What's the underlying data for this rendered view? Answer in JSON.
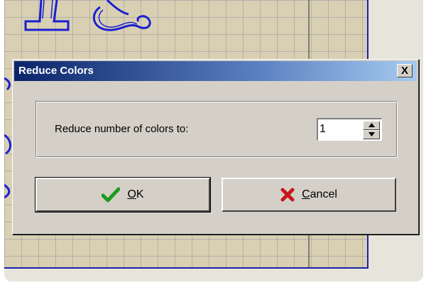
{
  "dialog": {
    "title": "Reduce Colors",
    "close_label": "X",
    "prompt_label": "Reduce number of colors to:",
    "colors_value": "1",
    "ok_label": "OK",
    "cancel_label": "Cancel"
  },
  "colors": {
    "title_start": "#0a246a",
    "title_end": "#a6caf0",
    "ok_check": "#1e9a1e",
    "cancel_x": "#c8161a",
    "canvas_outline": "#1a1fa8"
  },
  "icons": {
    "ok": "check-icon",
    "cancel": "x-mark-icon",
    "spin_up": "arrow-up-icon",
    "spin_down": "arrow-down-icon"
  }
}
